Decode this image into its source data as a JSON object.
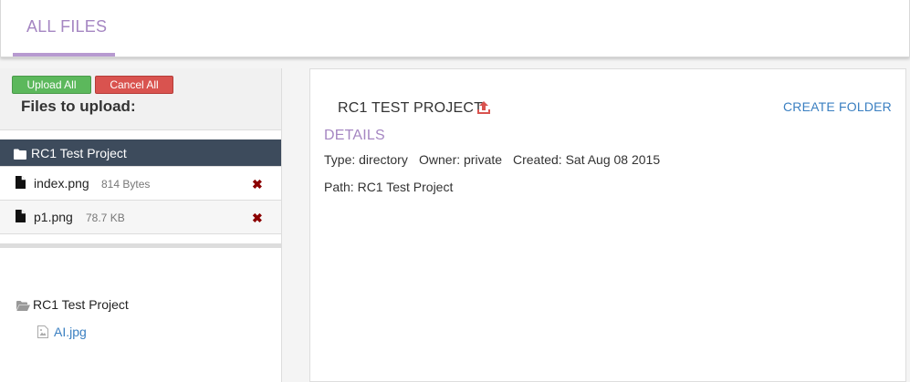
{
  "header": {
    "tab_label": "ALL FILES"
  },
  "upload": {
    "upload_all_label": "Upload All",
    "cancel_all_label": "Cancel All",
    "title": "Files to upload:",
    "project_row": "RC1 Test Project",
    "files": [
      {
        "name": "index.png",
        "size": "814 Bytes"
      },
      {
        "name": "p1.png",
        "size": "78.7 KB"
      }
    ]
  },
  "tree": {
    "root": "RC1 Test Project",
    "children": [
      "AI.jpg"
    ]
  },
  "details": {
    "project_title": "RC1 TEST PROJECT",
    "create_folder_label": "CREATE FOLDER",
    "section_title": "DETAILS",
    "type": "Type: directory",
    "owner": "Owner: private",
    "created": "Created: Sat Aug 08 2015",
    "path": "Path: RC1 Test Project"
  },
  "colors": {
    "accent": "#a586c2",
    "link": "#3a7fc1",
    "success": "#5cb85c",
    "danger": "#d9534f",
    "selected_row": "#3d4b5c"
  },
  "icons": [
    "folder-icon",
    "file-icon",
    "remove-icon",
    "upload-icon",
    "folder-open-icon",
    "image-file-icon"
  ]
}
